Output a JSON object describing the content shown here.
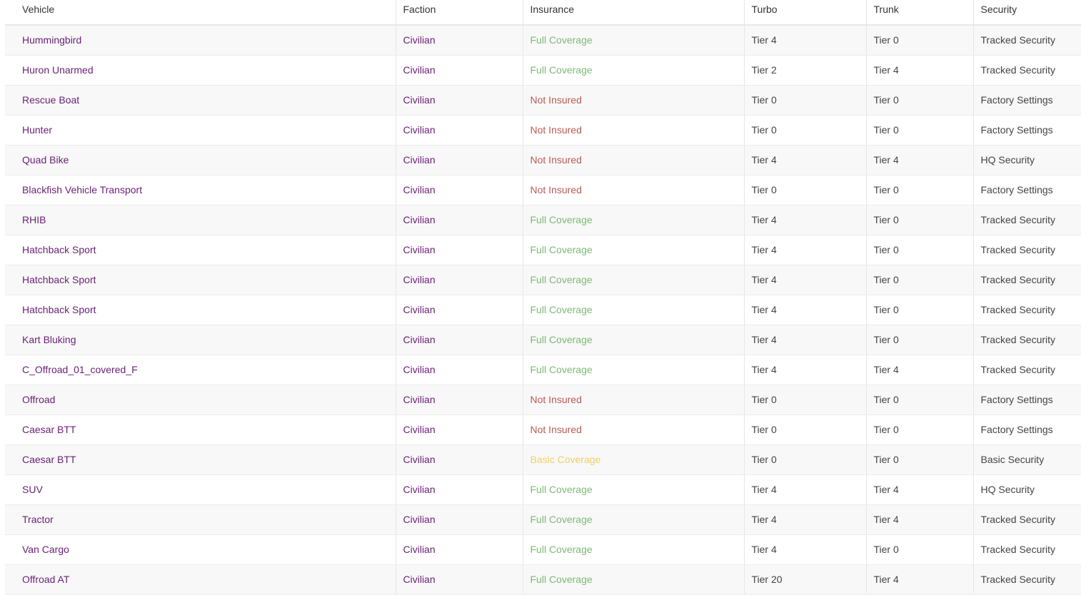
{
  "columns": [
    "Vehicle",
    "Faction",
    "Insurance",
    "Turbo",
    "Trunk",
    "Security"
  ],
  "status_colors": {
    "Full Coverage": "#7dba75",
    "Not Insured": "#b85c55",
    "Basic Coverage": "#f0d066"
  },
  "link_color": "#6b2277",
  "rows": [
    {
      "vehicle": "Hummingbird",
      "faction": "Civilian",
      "insurance": "Full Coverage",
      "turbo": "Tier 4",
      "trunk": "Tier 0",
      "security": "Tracked Security"
    },
    {
      "vehicle": "Huron Unarmed",
      "faction": "Civilian",
      "insurance": "Full Coverage",
      "turbo": "Tier 2",
      "trunk": "Tier 4",
      "security": "Tracked Security"
    },
    {
      "vehicle": "Rescue Boat",
      "faction": "Civilian",
      "insurance": "Not Insured",
      "turbo": "Tier 0",
      "trunk": "Tier 0",
      "security": "Factory Settings"
    },
    {
      "vehicle": "Hunter",
      "faction": "Civilian",
      "insurance": "Not Insured",
      "turbo": "Tier 0",
      "trunk": "Tier 0",
      "security": "Factory Settings"
    },
    {
      "vehicle": "Quad Bike",
      "faction": "Civilian",
      "insurance": "Not Insured",
      "turbo": "Tier 4",
      "trunk": "Tier 4",
      "security": "HQ Security"
    },
    {
      "vehicle": "Blackfish Vehicle Transport",
      "faction": "Civilian",
      "insurance": "Not Insured",
      "turbo": "Tier 0",
      "trunk": "Tier 0",
      "security": "Factory Settings"
    },
    {
      "vehicle": "RHIB",
      "faction": "Civilian",
      "insurance": "Full Coverage",
      "turbo": "Tier 4",
      "trunk": "Tier 0",
      "security": "Tracked Security"
    },
    {
      "vehicle": "Hatchback Sport",
      "faction": "Civilian",
      "insurance": "Full Coverage",
      "turbo": "Tier 4",
      "trunk": "Tier 0",
      "security": "Tracked Security"
    },
    {
      "vehicle": "Hatchback Sport",
      "faction": "Civilian",
      "insurance": "Full Coverage",
      "turbo": "Tier 4",
      "trunk": "Tier 0",
      "security": "Tracked Security"
    },
    {
      "vehicle": "Hatchback Sport",
      "faction": "Civilian",
      "insurance": "Full Coverage",
      "turbo": "Tier 4",
      "trunk": "Tier 0",
      "security": "Tracked Security"
    },
    {
      "vehicle": "Kart Bluking",
      "faction": "Civilian",
      "insurance": "Full Coverage",
      "turbo": "Tier 4",
      "trunk": "Tier 0",
      "security": "Tracked Security"
    },
    {
      "vehicle": "C_Offroad_01_covered_F",
      "faction": "Civilian",
      "insurance": "Full Coverage",
      "turbo": "Tier 4",
      "trunk": "Tier 4",
      "security": "Tracked Security"
    },
    {
      "vehicle": "Offroad",
      "faction": "Civilian",
      "insurance": "Not Insured",
      "turbo": "Tier 0",
      "trunk": "Tier 0",
      "security": "Factory Settings"
    },
    {
      "vehicle": "Caesar BTT",
      "faction": "Civilian",
      "insurance": "Not Insured",
      "turbo": "Tier 0",
      "trunk": "Tier 0",
      "security": "Factory Settings"
    },
    {
      "vehicle": "Caesar BTT",
      "faction": "Civilian",
      "insurance": "Basic Coverage",
      "turbo": "Tier 0",
      "trunk": "Tier 0",
      "security": "Basic Security"
    },
    {
      "vehicle": "SUV",
      "faction": "Civilian",
      "insurance": "Full Coverage",
      "turbo": "Tier 4",
      "trunk": "Tier 4",
      "security": "HQ Security"
    },
    {
      "vehicle": "Tractor",
      "faction": "Civilian",
      "insurance": "Full Coverage",
      "turbo": "Tier 4",
      "trunk": "Tier 4",
      "security": "Tracked Security"
    },
    {
      "vehicle": "Van Cargo",
      "faction": "Civilian",
      "insurance": "Full Coverage",
      "turbo": "Tier 4",
      "trunk": "Tier 0",
      "security": "Tracked Security"
    },
    {
      "vehicle": "Offroad AT",
      "faction": "Civilian",
      "insurance": "Full Coverage",
      "turbo": "Tier 20",
      "trunk": "Tier 4",
      "security": "Tracked Security"
    }
  ]
}
